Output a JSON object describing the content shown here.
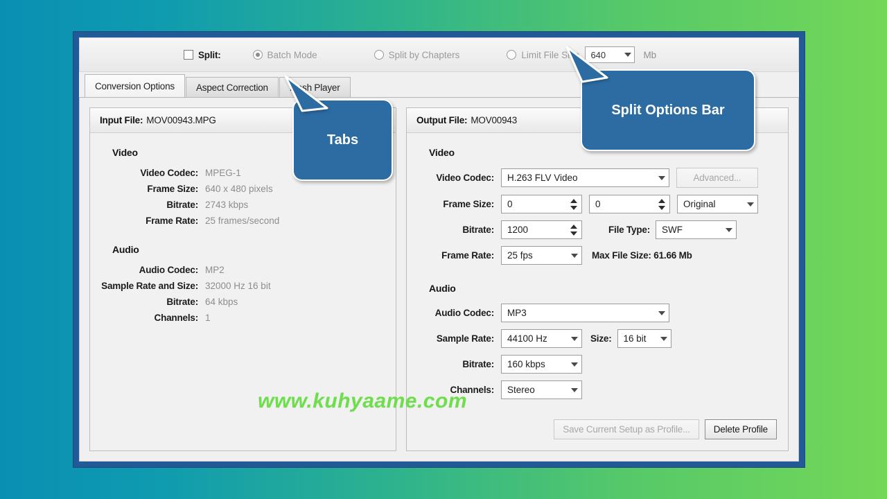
{
  "background": {
    "from": "#0a8fb3",
    "to": "#74d857"
  },
  "window": {
    "frame_color": "#215a96"
  },
  "split_bar": {
    "split_label": "Split:",
    "split_checked": false,
    "options": [
      {
        "name": "batch-mode",
        "label": "Batch Mode",
        "selected": true,
        "disabled": true
      },
      {
        "name": "split-by-chapters",
        "label": "Split by Chapters",
        "selected": false,
        "disabled": true
      },
      {
        "name": "limit-file-size",
        "label": "Limit File Size",
        "selected": false,
        "disabled": true
      }
    ],
    "limit_value": "640",
    "limit_unit": "Mb"
  },
  "tabs": [
    {
      "label": "Conversion Options",
      "active": true
    },
    {
      "label": "Aspect Correction",
      "active": false
    },
    {
      "label": "Flash Player",
      "active": false
    }
  ],
  "input_panel": {
    "header_label": "Input File:",
    "header_value": "MOV00943.MPG",
    "video_title": "Video",
    "video_rows": [
      {
        "key": "Video Codec:",
        "value": "MPEG-1"
      },
      {
        "key": "Frame Size:",
        "value": "640 x 480 pixels"
      },
      {
        "key": "Bitrate:",
        "value": "2743 kbps"
      },
      {
        "key": "Frame Rate:",
        "value": "25 frames/second"
      }
    ],
    "audio_title": "Audio",
    "audio_rows": [
      {
        "key": "Audio Codec:",
        "value": "MP2"
      },
      {
        "key": "Sample Rate and Size:",
        "value": "32000 Hz 16 bit"
      },
      {
        "key": "Bitrate:",
        "value": "64 kbps"
      },
      {
        "key": "Channels:",
        "value": "1"
      }
    ]
  },
  "output_panel": {
    "header_label": "Output File:",
    "header_value": "MOV00943",
    "video_title": "Video",
    "video_codec_label": "Video Codec:",
    "video_codec_value": "H.263 FLV Video",
    "advanced_button": "Advanced...",
    "frame_size_label": "Frame Size:",
    "frame_width": "0",
    "frame_height": "0",
    "aspect_value": "Original",
    "bitrate_label": "Bitrate:",
    "bitrate_value": "1200",
    "file_type_label": "File Type:",
    "file_type_value": "SWF",
    "frame_rate_label": "Frame Rate:",
    "frame_rate_value": "25 fps",
    "max_file_size": "Max File Size:  61.66 Mb",
    "audio_title": "Audio",
    "audio_codec_label": "Audio Codec:",
    "audio_codec_value": "MP3",
    "sample_rate_label": "Sample Rate:",
    "sample_rate_value": "44100 Hz",
    "size_label": "Size:",
    "size_value": "16 bit",
    "audio_bitrate_label": "Bitrate:",
    "audio_bitrate_value": "160 kbps",
    "channels_label": "Channels:",
    "channels_value": "Stereo",
    "save_profile_button": "Save Current Setup as Profile...",
    "delete_profile_button": "Delete Profile"
  },
  "callouts": [
    {
      "name": "tabs",
      "text": "Tabs",
      "color": "#2c6ca3"
    },
    {
      "name": "split-options-bar",
      "text": "Split Options Bar",
      "color": "#2c6ca3"
    }
  ],
  "watermark": {
    "text": "www.kuhyaame.com",
    "color": "#6ede4c"
  }
}
